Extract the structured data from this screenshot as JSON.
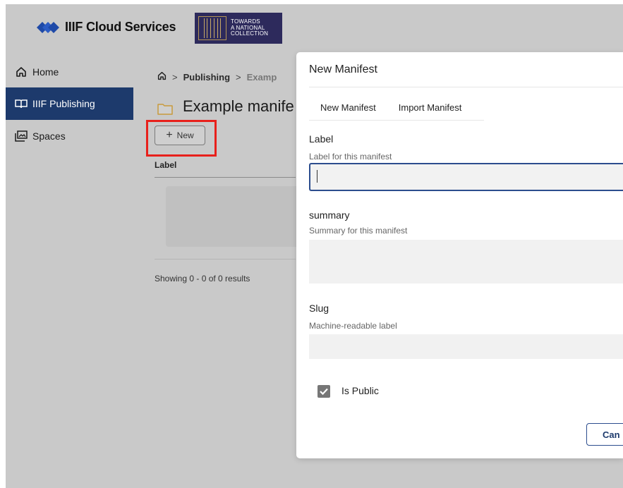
{
  "header": {
    "app_name": "IIIF Cloud Services",
    "partner_logo_text": [
      "TOWARDS",
      "A NATIONAL",
      "COLLECTION"
    ]
  },
  "sidebar": {
    "items": [
      {
        "label": "Home",
        "icon": "home-icon",
        "active": false
      },
      {
        "label": "IIIF Publishing",
        "icon": "book-icon",
        "active": true
      },
      {
        "label": "Spaces",
        "icon": "image-stack-icon",
        "active": false
      }
    ]
  },
  "main": {
    "breadcrumb": {
      "home_icon": "home-icon",
      "separator": ">",
      "items": [
        "Publishing",
        "Examp"
      ]
    },
    "title": "Example manife",
    "title_icon": "folder-icon",
    "new_button_label": "New",
    "table": {
      "columns": [
        "Label"
      ],
      "rows": []
    },
    "results_text": "Showing 0 - 0 of 0 results"
  },
  "modal": {
    "title": "New Manifest",
    "tabs": [
      {
        "label": "New Manifest",
        "active": true
      },
      {
        "label": "Import Manifest",
        "active": false
      }
    ],
    "fields": {
      "label": {
        "label": "Label",
        "help": "Label for this manifest",
        "value": ""
      },
      "summary": {
        "label": "summary",
        "help": "Summary for this manifest",
        "value": ""
      },
      "slug": {
        "label": "Slug",
        "help": "Machine-readable label",
        "value": ""
      }
    },
    "is_public": {
      "label": "Is Public",
      "checked": true
    },
    "cancel_label": "Can"
  },
  "colors": {
    "nav_active": "#1d3a6c",
    "focus_border": "#2c4d8e",
    "highlight_box": "#e8201b",
    "overlay_gray": "#c9c9c9"
  }
}
